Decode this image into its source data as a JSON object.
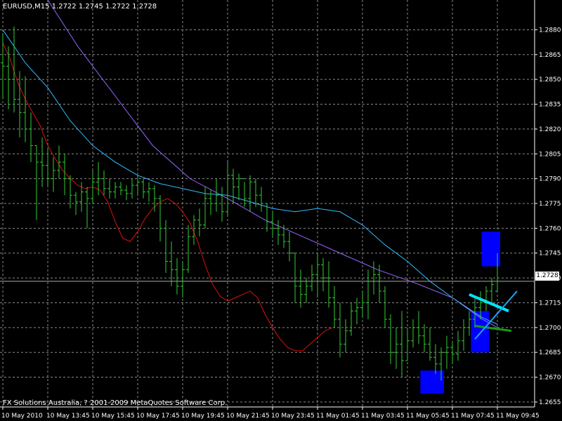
{
  "chart_data": {
    "type": "candlestick",
    "title": "EURUSD,M15  1.2722 1.2745 1.2722 1.2728",
    "copyright": "FX Solutions Australia, ? 2001-2009 MetaQuotes Software Corp.",
    "current_price": "1.2728",
    "current_price_value": 1.2728,
    "ylim": [
      1.2652,
      1.2898
    ],
    "y_ticks": [
      {
        "value": 1.288,
        "label": "1.2880"
      },
      {
        "value": 1.2865,
        "label": "1.2865"
      },
      {
        "value": 1.285,
        "label": "1.2850"
      },
      {
        "value": 1.2835,
        "label": "1.2835"
      },
      {
        "value": 1.282,
        "label": "1.2820"
      },
      {
        "value": 1.2805,
        "label": "1.2805"
      },
      {
        "value": 1.279,
        "label": "1.2790"
      },
      {
        "value": 1.2775,
        "label": "1.2775"
      },
      {
        "value": 1.276,
        "label": "1.2760"
      },
      {
        "value": 1.2745,
        "label": "1.2745"
      },
      {
        "value": 1.273,
        "label": "1.2730"
      },
      {
        "value": 1.2715,
        "label": "1.2715"
      },
      {
        "value": 1.27,
        "label": "1.2700"
      },
      {
        "value": 1.2685,
        "label": "1.2685"
      },
      {
        "value": 1.267,
        "label": "1.2670"
      },
      {
        "value": 1.2655,
        "label": "1.2655"
      }
    ],
    "x_ticks": [
      {
        "bar": 0,
        "label": "10 May 2010"
      },
      {
        "bar": 8,
        "label": "10 May 13:45"
      },
      {
        "bar": 16,
        "label": "10 May 15:45"
      },
      {
        "bar": 24,
        "label": "10 May 17:45"
      },
      {
        "bar": 32,
        "label": "10 May 19:45"
      },
      {
        "bar": 40,
        "label": "10 May 21:45"
      },
      {
        "bar": 48,
        "label": "10 May 23:45"
      },
      {
        "bar": 56,
        "label": "11 May 01:45"
      },
      {
        "bar": 64,
        "label": "11 May 03:45"
      },
      {
        "bar": 72,
        "label": "11 May 05:45"
      },
      {
        "bar": 80,
        "label": "11 May 07:45"
      },
      {
        "bar": 88,
        "label": "11 May 09:45"
      }
    ],
    "bars": [
      {
        "h": 1.2878,
        "l": 1.2838,
        "o": 1.286,
        "c": 1.2858
      },
      {
        "h": 1.287,
        "l": 1.2832,
        "o": 1.2858,
        "c": 1.285
      },
      {
        "h": 1.2882,
        "l": 1.283,
        "o": 1.285,
        "c": 1.2838
      },
      {
        "h": 1.2855,
        "l": 1.2815,
        "o": 1.2838,
        "c": 1.283
      },
      {
        "h": 1.2852,
        "l": 1.2812,
        "o": 1.283,
        "c": 1.282
      },
      {
        "h": 1.283,
        "l": 1.28,
        "o": 1.282,
        "c": 1.281
      },
      {
        "h": 1.281,
        "l": 1.2765,
        "o": 1.281,
        "c": 1.28
      },
      {
        "h": 1.2815,
        "l": 1.2785,
        "o": 1.28,
        "c": 1.2798
      },
      {
        "h": 1.2808,
        "l": 1.2786,
        "o": 1.2798,
        "c": 1.279
      },
      {
        "h": 1.2803,
        "l": 1.2782,
        "o": 1.279,
        "c": 1.2795
      },
      {
        "h": 1.281,
        "l": 1.279,
        "o": 1.2795,
        "c": 1.28
      },
      {
        "h": 1.2805,
        "l": 1.278,
        "o": 1.28,
        "c": 1.279
      },
      {
        "h": 1.2792,
        "l": 1.2772,
        "o": 1.279,
        "c": 1.278
      },
      {
        "h": 1.2782,
        "l": 1.2768,
        "o": 1.278,
        "c": 1.2776
      },
      {
        "h": 1.2788,
        "l": 1.277,
        "o": 1.2776,
        "c": 1.2782
      },
      {
        "h": 1.2785,
        "l": 1.276,
        "o": 1.2782,
        "c": 1.2778
      },
      {
        "h": 1.2795,
        "l": 1.2775,
        "o": 1.2778,
        "c": 1.2788
      },
      {
        "h": 1.28,
        "l": 1.278,
        "o": 1.2788,
        "c": 1.279
      },
      {
        "h": 1.2795,
        "l": 1.278,
        "o": 1.279,
        "c": 1.2784
      },
      {
        "h": 1.279,
        "l": 1.2778,
        "o": 1.2784,
        "c": 1.2782
      },
      {
        "h": 1.2788,
        "l": 1.2778,
        "o": 1.2782,
        "c": 1.2785
      },
      {
        "h": 1.2788,
        "l": 1.278,
        "o": 1.2785,
        "c": 1.2783
      },
      {
        "h": 1.2786,
        "l": 1.2777,
        "o": 1.2783,
        "c": 1.2781
      },
      {
        "h": 1.279,
        "l": 1.2778,
        "o": 1.2781,
        "c": 1.2786
      },
      {
        "h": 1.2792,
        "l": 1.278,
        "o": 1.2786,
        "c": 1.2788
      },
      {
        "h": 1.279,
        "l": 1.2778,
        "o": 1.2788,
        "c": 1.2782
      },
      {
        "h": 1.2788,
        "l": 1.2776,
        "o": 1.2782,
        "c": 1.2784
      },
      {
        "h": 1.2786,
        "l": 1.277,
        "o": 1.2784,
        "c": 1.2778
      },
      {
        "h": 1.278,
        "l": 1.2752,
        "o": 1.2778,
        "c": 1.276
      },
      {
        "h": 1.2765,
        "l": 1.2733,
        "o": 1.276,
        "c": 1.274
      },
      {
        "h": 1.2752,
        "l": 1.2725,
        "o": 1.274,
        "c": 1.2735
      },
      {
        "h": 1.2742,
        "l": 1.272,
        "o": 1.2735,
        "c": 1.2725
      },
      {
        "h": 1.274,
        "l": 1.2718,
        "o": 1.2725,
        "c": 1.2735
      },
      {
        "h": 1.2762,
        "l": 1.2733,
        "o": 1.2735,
        "c": 1.2755
      },
      {
        "h": 1.2768,
        "l": 1.275,
        "o": 1.2755,
        "c": 1.2765
      },
      {
        "h": 1.2772,
        "l": 1.2755,
        "o": 1.2765,
        "c": 1.2762
      },
      {
        "h": 1.2785,
        "l": 1.276,
        "o": 1.2762,
        "c": 1.2778
      },
      {
        "h": 1.2783,
        "l": 1.2768,
        "o": 1.2778,
        "c": 1.2775
      },
      {
        "h": 1.279,
        "l": 1.277,
        "o": 1.2775,
        "c": 1.278
      },
      {
        "h": 1.2785,
        "l": 1.2764,
        "o": 1.278,
        "c": 1.277
      },
      {
        "h": 1.28,
        "l": 1.2768,
        "o": 1.277,
        "c": 1.2792
      },
      {
        "h": 1.2796,
        "l": 1.2775,
        "o": 1.2792,
        "c": 1.2785
      },
      {
        "h": 1.2793,
        "l": 1.2777,
        "o": 1.2785,
        "c": 1.279
      },
      {
        "h": 1.2788,
        "l": 1.2773,
        "o": 1.279,
        "c": 1.2778
      },
      {
        "h": 1.2792,
        "l": 1.277,
        "o": 1.2778,
        "c": 1.2788
      },
      {
        "h": 1.279,
        "l": 1.2773,
        "o": 1.2788,
        "c": 1.278
      },
      {
        "h": 1.2785,
        "l": 1.277,
        "o": 1.278,
        "c": 1.2775
      },
      {
        "h": 1.2775,
        "l": 1.2758,
        "o": 1.2775,
        "c": 1.2764
      },
      {
        "h": 1.277,
        "l": 1.2755,
        "o": 1.2764,
        "c": 1.276
      },
      {
        "h": 1.2765,
        "l": 1.275,
        "o": 1.276,
        "c": 1.2756
      },
      {
        "h": 1.2762,
        "l": 1.2748,
        "o": 1.2756,
        "c": 1.2752
      },
      {
        "h": 1.2758,
        "l": 1.274,
        "o": 1.2752,
        "c": 1.2745
      },
      {
        "h": 1.2745,
        "l": 1.2715,
        "o": 1.2745,
        "c": 1.2725
      },
      {
        "h": 1.2735,
        "l": 1.2712,
        "o": 1.2725,
        "c": 1.272
      },
      {
        "h": 1.273,
        "l": 1.2715,
        "o": 1.272,
        "c": 1.2725
      },
      {
        "h": 1.2738,
        "l": 1.2722,
        "o": 1.2725,
        "c": 1.2732
      },
      {
        "h": 1.2745,
        "l": 1.2718,
        "o": 1.2732,
        "c": 1.2738
      },
      {
        "h": 1.2742,
        "l": 1.2722,
        "o": 1.2738,
        "c": 1.273
      },
      {
        "h": 1.274,
        "l": 1.2712,
        "o": 1.273,
        "c": 1.2718
      },
      {
        "h": 1.2725,
        "l": 1.27,
        "o": 1.2718,
        "c": 1.2705
      },
      {
        "h": 1.2715,
        "l": 1.2682,
        "o": 1.2705,
        "c": 1.269
      },
      {
        "h": 1.2705,
        "l": 1.2685,
        "o": 1.269,
        "c": 1.2698
      },
      {
        "h": 1.2715,
        "l": 1.2695,
        "o": 1.2698,
        "c": 1.271
      },
      {
        "h": 1.2718,
        "l": 1.2702,
        "o": 1.271,
        "c": 1.2712
      },
      {
        "h": 1.2722,
        "l": 1.2706,
        "o": 1.2712,
        "c": 1.2715
      },
      {
        "h": 1.2735,
        "l": 1.2705,
        "o": 1.2715,
        "c": 1.2728
      },
      {
        "h": 1.274,
        "l": 1.272,
        "o": 1.2728,
        "c": 1.2732
      },
      {
        "h": 1.2738,
        "l": 1.2715,
        "o": 1.2732,
        "c": 1.2722
      },
      {
        "h": 1.2725,
        "l": 1.27,
        "o": 1.2722,
        "c": 1.2705
      },
      {
        "h": 1.2708,
        "l": 1.2678,
        "o": 1.2705,
        "c": 1.2685
      },
      {
        "h": 1.27,
        "l": 1.2675,
        "o": 1.2685,
        "c": 1.269
      },
      {
        "h": 1.271,
        "l": 1.267,
        "o": 1.269,
        "c": 1.268
      },
      {
        "h": 1.27,
        "l": 1.268,
        "o": 1.268,
        "c": 1.2692
      },
      {
        "h": 1.2705,
        "l": 1.2688,
        "o": 1.2692,
        "c": 1.27
      },
      {
        "h": 1.271,
        "l": 1.269,
        "o": 1.27,
        "c": 1.2695
      },
      {
        "h": 1.2702,
        "l": 1.2685,
        "o": 1.2695,
        "c": 1.269
      },
      {
        "h": 1.27,
        "l": 1.268,
        "o": 1.269,
        "c": 1.2682
      },
      {
        "h": 1.269,
        "l": 1.2672,
        "o": 1.2682,
        "c": 1.2678
      },
      {
        "h": 1.2688,
        "l": 1.2668,
        "o": 1.2678,
        "c": 1.2685
      },
      {
        "h": 1.2695,
        "l": 1.2675,
        "o": 1.2685,
        "c": 1.2688
      },
      {
        "h": 1.2692,
        "l": 1.2678,
        "o": 1.2688,
        "c": 1.2684
      },
      {
        "h": 1.2698,
        "l": 1.268,
        "o": 1.2684,
        "c": 1.2692
      },
      {
        "h": 1.2705,
        "l": 1.2686,
        "o": 1.2692,
        "c": 1.27
      },
      {
        "h": 1.271,
        "l": 1.2695,
        "o": 1.27,
        "c": 1.2705
      },
      {
        "h": 1.2718,
        "l": 1.27,
        "o": 1.2705,
        "c": 1.2712
      },
      {
        "h": 1.2722,
        "l": 1.2705,
        "o": 1.2712,
        "c": 1.2715
      },
      {
        "h": 1.2725,
        "l": 1.271,
        "o": 1.2715,
        "c": 1.2722
      },
      {
        "h": 1.273,
        "l": 1.2715,
        "o": 1.2722,
        "c": 1.2726
      },
      {
        "h": 1.2745,
        "l": 1.2722,
        "o": 1.2722,
        "c": 1.2728
      }
    ],
    "ma_slow": [
      [
        0,
        1.2935
      ],
      [
        10,
        1.2905
      ],
      [
        20,
        1.287
      ],
      [
        30,
        1.284
      ],
      [
        40,
        1.281
      ],
      [
        50,
        1.279
      ],
      [
        60,
        1.2778
      ],
      [
        70,
        1.2765
      ],
      [
        80,
        1.2755
      ],
      [
        90,
        1.2745
      ],
      [
        100,
        1.2735
      ],
      [
        110,
        1.2727
      ],
      [
        120,
        1.2718
      ],
      [
        128,
        1.2705
      ],
      [
        132,
        1.27
      ]
    ],
    "ma_mid": [
      [
        0,
        1.288
      ],
      [
        6,
        1.286
      ],
      [
        12,
        1.2845
      ],
      [
        18,
        1.2825
      ],
      [
        24,
        1.281
      ],
      [
        30,
        1.28
      ],
      [
        36,
        1.2792
      ],
      [
        42,
        1.2787
      ],
      [
        48,
        1.2784
      ],
      [
        54,
        1.2781
      ],
      [
        60,
        1.278
      ],
      [
        66,
        1.2776
      ],
      [
        72,
        1.2772
      ],
      [
        78,
        1.277
      ],
      [
        84,
        1.2772
      ],
      [
        90,
        1.277
      ],
      [
        96,
        1.2762
      ],
      [
        102,
        1.275
      ],
      [
        108,
        1.274
      ],
      [
        114,
        1.2728
      ],
      [
        120,
        1.2718
      ],
      [
        124,
        1.2712
      ],
      [
        128,
        1.2706
      ],
      [
        132,
        1.2702
      ]
    ],
    "ma_fast": [
      [
        0,
        1.2872
      ],
      [
        4,
        1.2856
      ],
      [
        8,
        1.284
      ],
      [
        12,
        1.2828
      ],
      [
        16,
        1.2812
      ],
      [
        20,
        1.28
      ],
      [
        24,
        1.2793
      ],
      [
        28,
        1.2786
      ],
      [
        32,
        1.2783
      ],
      [
        36,
        1.2782
      ],
      [
        40,
        1.2783
      ],
      [
        44,
        1.278
      ],
      [
        48,
        1.2772
      ],
      [
        52,
        1.2765
      ],
      [
        56,
        1.277
      ],
      [
        60,
        1.2776
      ],
      [
        64,
        1.2772
      ],
      [
        68,
        1.276
      ],
      [
        72,
        1.2746
      ],
      [
        76,
        1.2735
      ],
      [
        80,
        1.2722
      ],
      [
        84,
        1.2716
      ],
      [
        88,
        1.2712
      ],
      [
        92,
        1.2708
      ],
      [
        96,
        1.27
      ],
      [
        100,
        1.2694
      ],
      [
        104,
        1.269
      ],
      [
        108,
        1.2693
      ],
      [
        112,
        1.27
      ]
    ],
    "ma_purple": [
      [
        0,
        1.288
      ],
      [
        6,
        1.2866
      ],
      [
        12,
        1.285
      ],
      [
        18,
        1.2835
      ],
      [
        24,
        1.282
      ],
      [
        28,
        1.281
      ],
      [
        32,
        1.28
      ],
      [
        36,
        1.2792
      ],
      [
        40,
        1.2788
      ],
      [
        44,
        1.2786
      ],
      [
        48,
        1.2786
      ],
      [
        52,
        1.2787
      ],
      [
        56,
        1.2784
      ],
      [
        60,
        1.2778
      ],
      [
        64,
        1.277
      ],
      [
        68,
        1.2765
      ],
      [
        72,
        1.276
      ],
      [
        76,
        1.2754
      ],
      [
        80,
        1.275
      ],
      [
        84,
        1.2745
      ],
      [
        88,
        1.2738
      ],
      [
        92,
        1.273
      ],
      [
        96,
        1.2726
      ],
      [
        100,
        1.2722
      ],
      [
        104,
        1.2718
      ],
      [
        108,
        1.2712
      ]
    ],
    "red_ma": [
      [
        0,
        1.2872
      ],
      [
        2,
        1.2862
      ],
      [
        4,
        1.2848
      ],
      [
        6,
        1.2838
      ],
      [
        8,
        1.283
      ],
      [
        10,
        1.2822
      ],
      [
        12,
        1.281
      ],
      [
        14,
        1.2802
      ],
      [
        16,
        1.2795
      ],
      [
        18,
        1.279
      ],
      [
        20,
        1.2786
      ],
      [
        22,
        1.2784
      ],
      [
        24,
        1.2785
      ],
      [
        26,
        1.2783
      ],
      [
        28,
        1.2776
      ],
      [
        30,
        1.2764
      ],
      [
        32,
        1.2754
      ],
      [
        34,
        1.2752
      ],
      [
        36,
        1.2758
      ],
      [
        38,
        1.2766
      ],
      [
        40,
        1.2772
      ],
      [
        42,
        1.2776
      ],
      [
        44,
        1.2778
      ],
      [
        46,
        1.2775
      ],
      [
        48,
        1.277
      ],
      [
        50,
        1.2763
      ],
      [
        52,
        1.2752
      ],
      [
        54,
        1.2738
      ],
      [
        56,
        1.2726
      ],
      [
        58,
        1.2719
      ],
      [
        60,
        1.2716
      ],
      [
        62,
        1.2718
      ],
      [
        64,
        1.272
      ],
      [
        66,
        1.2722
      ],
      [
        68,
        1.2718
      ],
      [
        70,
        1.2708
      ],
      [
        72,
        1.27
      ],
      [
        74,
        1.2693
      ],
      [
        76,
        1.2688
      ],
      [
        78,
        1.2686
      ],
      [
        80,
        1.2686
      ],
      [
        82,
        1.269
      ],
      [
        84,
        1.2694
      ],
      [
        86,
        1.2698
      ],
      [
        88,
        1.27
      ]
    ],
    "blocks": [
      {
        "x0": 85.2,
        "x1": 88.5,
        "y0": 1.2737,
        "y1": 1.2758,
        "color": "#0000ff"
      },
      {
        "x0": 83.3,
        "x1": 86.5,
        "y0": 1.2685,
        "y1": 1.271,
        "color": "#0000ff"
      },
      {
        "x0": 74.3,
        "x1": 78.5,
        "y0": 1.266,
        "y1": 1.2674,
        "color": "#0000ff"
      }
    ],
    "trend_lines": [
      {
        "x0": 83.0,
        "y0": 1.272,
        "x1": 90.0,
        "y1": 1.271,
        "color": "#00e5ff",
        "width": 4
      },
      {
        "x0": 84.0,
        "y0": 1.2701,
        "x1": 90.5,
        "y1": 1.2698,
        "color": "#1a9a1a",
        "width": 3
      },
      {
        "x0": 84.0,
        "y0": 1.2693,
        "x1": 91.5,
        "y1": 1.2722,
        "color": "#1aa0ff",
        "width": 2
      }
    ],
    "colors": {
      "background": "#000000",
      "grid": "#8a8a8a",
      "bars": "#33cc33",
      "ma_slow": "#9a66ff",
      "ma_mid": "#33bbff",
      "red_ma": "#dd1111",
      "axis_text": "#ffffff"
    }
  }
}
